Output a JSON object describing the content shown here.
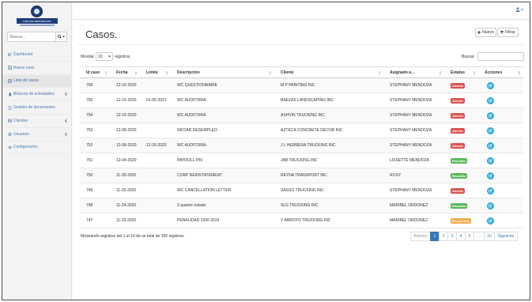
{
  "app": {
    "logo_text": "CMY TAX SERVICES INC"
  },
  "sidebar": {
    "search_placeholder": "Buscar...",
    "items": [
      {
        "label": "Dashboard",
        "icon": "line-chart-icon",
        "active": false
      },
      {
        "label": "Nuevo caso",
        "icon": "list-alt-icon",
        "active": false
      },
      {
        "label": "Lista de casos",
        "icon": "list-icon",
        "active": true
      },
      {
        "label": "Bitacora de actividades",
        "icon": "book-icon",
        "active": false
      },
      {
        "label": "Gestión de documentos",
        "icon": "file-icon",
        "active": false
      },
      {
        "label": "Clientes",
        "icon": "id-card-icon",
        "active": false
      },
      {
        "label": "Usuarios",
        "icon": "users-icon",
        "active": false
      },
      {
        "label": "Configuración",
        "icon": "gear-icon",
        "active": false
      }
    ]
  },
  "main": {
    "title": "Casos.",
    "new_button": "Nuevo",
    "filter_button": "Filtrar",
    "show_prefix": "Mostrar",
    "show_value": "10",
    "show_suffix": "registros",
    "search_label": "Buscar:",
    "columns": [
      "Id caso",
      "Fecha",
      "Limite",
      "Descripción",
      "Cliente",
      "Asignado a...",
      "Estatus",
      "Acciones"
    ],
    "rows": [
      {
        "id": "756",
        "fecha": "12-16-2020",
        "limite": "",
        "descripcion": "WC QUESTIONNAIRE",
        "cliente": "M P PAINTING INC",
        "asignado": "STEPHANY MENDOZA",
        "estatus": "Abierto",
        "status_color": "#d9534f"
      },
      {
        "id": "755",
        "fecha": "12-15-2020",
        "limite": "01-05-2021",
        "descripcion": "WC AUDITORIA",
        "cliente": "BAEZAS LANDSCAPING INC",
        "asignado": "STEPHANY MENDOZA",
        "estatus": "Abierto",
        "status_color": "#d9534f"
      },
      {
        "id": "754",
        "fecha": "12-15-2020",
        "limite": "",
        "descripcion": "WC AUDITORIA",
        "cliente": "ASHVIN TRUCKING INC",
        "asignado": "STEPHANY MENDOZA",
        "estatus": "Abierto",
        "status_color": "#d9534f"
      },
      {
        "id": "753",
        "fecha": "12-08-2020",
        "limite": "",
        "descripcion": "INICIAR DESEMPLEO",
        "cliente": "AZTECA CONCRETE DECOR INC",
        "asignado": "STEPHANY MENDOZA",
        "estatus": "Abierto",
        "status_color": "#d9534f"
      },
      {
        "id": "752",
        "fecha": "12-08-2020",
        "limite": "12-30-2020",
        "descripcion": "WC AUDITORIA",
        "cliente": "J L HERRERA TRUCKING INC",
        "asignado": "STEPHANY MENDOZA",
        "estatus": "Abierto",
        "status_color": "#d9534f"
      },
      {
        "id": "751",
        "fecha": "12-04-2020",
        "limite": "",
        "descripcion": "PAYROLL PIN",
        "cliente": "JAB TRUCKING INC",
        "asignado": "LISSETTE MENDOZA",
        "estatus": "Resuelto",
        "status_color": "#5cb85c"
      },
      {
        "id": "750",
        "fecha": "11-30-2020",
        "limite": "",
        "descripcion": "CORP REINSTATEMENT",
        "cliente": "REYNA TRANSPORT INC",
        "asignado": "ROSY",
        "estatus": "Resuelto",
        "status_color": "#5cb85c"
      },
      {
        "id": "749",
        "fecha": "11-25-2020",
        "limite": "",
        "descripcion": "WC CANCELLATION LETTER",
        "cliente": "SASSO TRUCKING INC",
        "asignado": "STEPHANY MENDOZA",
        "estatus": "Abierto",
        "status_color": "#d9534f"
      },
      {
        "id": "748",
        "fecha": "11-24-2020",
        "limite": "",
        "descripcion": "3 quarter estado",
        "cliente": "SLG TRUCKING INC",
        "asignado": "MARIBEL ORDONEZ",
        "estatus": "Resuelto",
        "status_color": "#5cb85c"
      },
      {
        "id": "747",
        "fecha": "11-23-2020",
        "limite": "",
        "descripcion": "PENALIDAD 2290 2019",
        "cliente": "Y ARROYO TRUCKING INC",
        "asignado": "MARIBEL ORDONEZ",
        "estatus": "En proceso",
        "status_color": "#f0ad4e"
      }
    ],
    "info_text": "Mostrando registros del 1 al 10 de un total de 100 registros",
    "pagination": {
      "prev": "Anterior",
      "pages": [
        "1",
        "2",
        "3",
        "4",
        "5",
        "...",
        "10"
      ],
      "current": "1",
      "next": "Siguiente"
    }
  },
  "colors": {
    "brand_navy": "#1f3d7a",
    "link_blue": "#337ab7",
    "action_cyan": "#29a8e0"
  }
}
